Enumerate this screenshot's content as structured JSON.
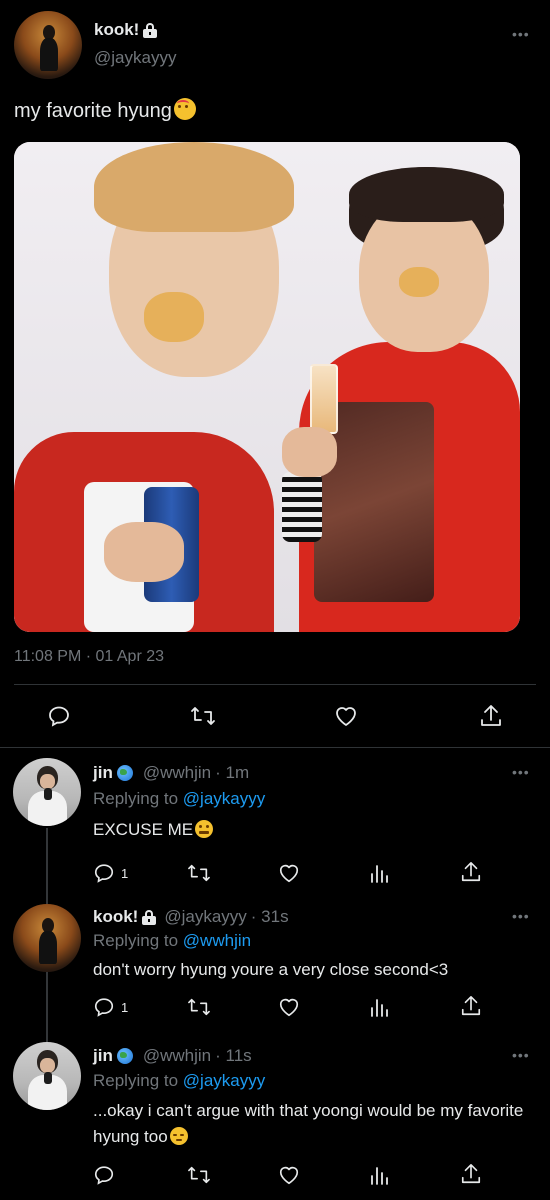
{
  "main_tweet": {
    "display_name": "kook!",
    "handle": "@jaykayyy",
    "text": "my favorite hyung",
    "emoji": "smiling-face-with-hearts",
    "timestamp": "11:08 PM · 01 Apr 23",
    "photo_description_icon": "photo"
  },
  "replies": [
    {
      "display_name": "jin",
      "handle": "@wwhjin",
      "time": "· 1m",
      "replying_label": "Replying to",
      "replying_to": "@jaykayyy",
      "text": "EXCUSE ME",
      "emoji": "grimacing",
      "reply_count": "1"
    },
    {
      "display_name": "kook!",
      "handle": "@jaykayyy",
      "time": "· 31s",
      "replying_label": "Replying to",
      "replying_to": "@wwhjin",
      "text": "don't worry hyung youre a very close second<3",
      "reply_count": "1"
    },
    {
      "display_name": "jin",
      "handle": "@wwhjin",
      "time": "· 11s",
      "replying_label": "Replying to",
      "replying_to": "@jaykayyy",
      "text": "...okay i can't argue with that yoongi would be my favorite hyung too",
      "emoji": "pensive"
    }
  ],
  "icons": {
    "reply": "reply-icon",
    "retweet": "retweet-icon",
    "like": "heart-icon",
    "views": "views-icon",
    "share": "share-icon",
    "more": "more-icon",
    "lock": "lock-icon",
    "globe": "globe-icon"
  },
  "colors": {
    "background": "#000000",
    "text": "#e7e9ea",
    "muted": "#71767b",
    "accent": "#1d9bf0",
    "divider": "#2f3336"
  }
}
